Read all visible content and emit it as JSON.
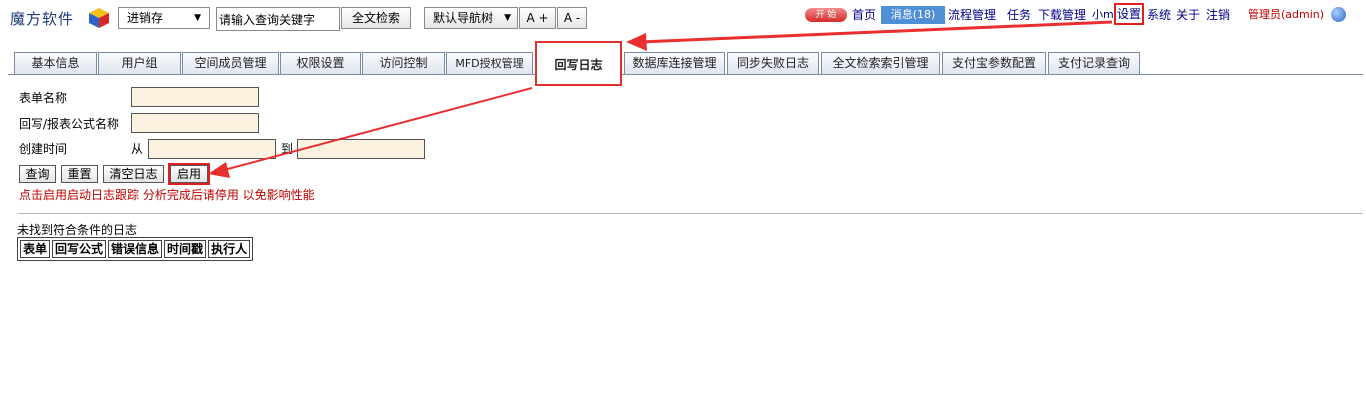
{
  "header": {
    "logo_text": "魔方软件",
    "module_select": "进销存",
    "search_value": "请输入查询关键字",
    "fulltext_button": "全文检索",
    "navtree_select": "默认导航树",
    "font_increase": "A +",
    "font_decrease": "A -"
  },
  "topnav": {
    "start": "开 始",
    "home": "首页",
    "messages": "消息(18)",
    "workflow": "流程管理",
    "tasks": "任务",
    "downloads": "下载管理",
    "small": "小m",
    "settings": "设置",
    "system": "系统",
    "about": "关于",
    "logout": "注销",
    "admin": "管理员(admin)"
  },
  "tabs": [
    "基本信息",
    "用户组",
    "空间成员管理",
    "权限设置",
    "访问控制",
    "MFD授权管理",
    "回写日志",
    "数据库连接管理",
    "同步失败日志",
    "全文检索索引管理",
    "支付宝参数配置",
    "支付记录查询"
  ],
  "form": {
    "form_name_label": "表单名称",
    "formula_label": "回写/报表公式名称",
    "created_label": "创建时间",
    "from_label": "从",
    "to_label": "到",
    "query_button": "查询",
    "reset_button": "重置",
    "clear_button": "清空日志",
    "enable_button": "启用",
    "hint": "点击启用启动日志跟踪 分析完成后请停用 以免影响性能"
  },
  "results": {
    "empty_text": "未找到符合条件的日志",
    "columns": [
      "表单",
      "回写公式",
      "错误信息",
      "时间戳",
      "执行人"
    ]
  },
  "colors": {
    "accent_red": "#e03030",
    "field_bg": "#fbf3df",
    "link_blue": "#00008b"
  }
}
